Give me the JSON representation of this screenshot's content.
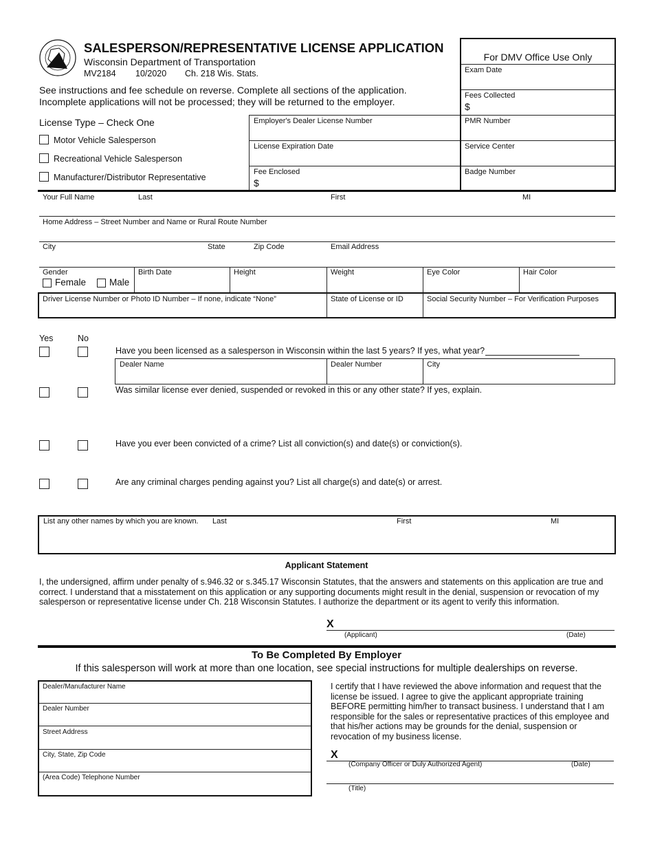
{
  "header": {
    "title": "SALESPERSON/REPRESENTATIVE LICENSE APPLICATION",
    "agency": "Wisconsin Department of Transportation",
    "form_number": "MV2184",
    "revision": "10/2020",
    "statute": "Ch. 218 Wis. Stats.",
    "logo_text": "WISCONSIN DEPARTMENT OF TRANSPORTATION"
  },
  "instructions": [
    "See instructions and fee schedule on reverse. Complete all sections of the application.",
    "Incomplete applications will not be processed; they will be returned to the employer."
  ],
  "dmv": {
    "title": "For DMV Office Use Only",
    "fields": [
      "Exam Date",
      "Fees Collected",
      "PMR Number",
      "Service Center",
      "Badge Number"
    ],
    "dollar": "$"
  },
  "license_type": {
    "label": "License Type – Check One",
    "options": [
      "Motor Vehicle Salesperson",
      "Recreational Vehicle Salesperson",
      "Manufacturer/Distributor Representative"
    ]
  },
  "employer_fields": {
    "dealer_license": "Employer's Dealer License Number",
    "expiration": "License Expiration Date",
    "fee": "Fee Enclosed",
    "dollar": "$"
  },
  "name_row": {
    "label": "Your Full Name",
    "last": "Last",
    "first": "First",
    "mi": "MI"
  },
  "address": "Home Address – Street Number and Name or Rural Route Number",
  "city_row": {
    "city": "City",
    "state": "State",
    "zip": "Zip Code",
    "email": "Email Address"
  },
  "physical": {
    "gender": "Gender",
    "female": "Female",
    "male": "Male",
    "birth": "Birth Date",
    "height": "Height",
    "weight": "Weight",
    "eye": "Eye Color",
    "hair": "Hair Color"
  },
  "id_row": {
    "dl": "Driver License Number or Photo ID Number – If none, indicate “None”",
    "state": "State of License or ID",
    "ssn": "Social Security Number – For Verification Purposes"
  },
  "questions": {
    "yes": "Yes",
    "no": "No",
    "items": [
      "Have you been licensed as a salesperson in Wisconsin within the last 5 years? If yes, what year?",
      "Was similar license ever denied, suspended or revoked in this or any other state? If yes, explain.",
      "Have you ever been convicted of a crime? List all conviction(s) and date(s) or conviction(s).",
      "Are any criminal charges pending against you? List all charge(s) and date(s) or arrest."
    ],
    "dealer_name": "Dealer Name",
    "dealer_number": "Dealer Number",
    "city": "City"
  },
  "other_names": {
    "label": "List any other names by which you are known.",
    "last": "Last",
    "first": "First",
    "mi": "MI"
  },
  "statement": {
    "title": "Applicant Statement",
    "text": "I, the undersigned, affirm under penalty of s.946.32 or s.345.17 Wisconsin Statutes, that the answers and statements on this application are true and correct. I understand that a misstatement on this application or any supporting documents might result in the denial, suspension or revocation of my salesperson or representative license under Ch. 218 Wisconsin Statutes. I authorize the department or its agent to verify this information.",
    "x": "X",
    "applicant": "(Applicant)",
    "date": "(Date)"
  },
  "employer": {
    "title": "To Be Completed By Employer",
    "subtitle": "If this salesperson will work at more than one location, see special instructions for multiple dealerships on reverse.",
    "fields": [
      "Dealer/Manufacturer Name",
      "Dealer Number",
      "Street Address",
      "City, State, Zip Code",
      "(Area Code) Telephone Number"
    ],
    "certify": "I certify that I have reviewed the above information and request that the license be issued. I agree to give the applicant appropriate training BEFORE permitting him/her to transact business. I understand that I am responsible for the sales or representative practices of this employee and that his/her actions may be grounds for the denial, suspension or revocation of my business license.",
    "x": "X",
    "officer": "(Company Officer or Duly Authorized Agent)",
    "date": "(Date)",
    "title_label": "(Title)"
  }
}
